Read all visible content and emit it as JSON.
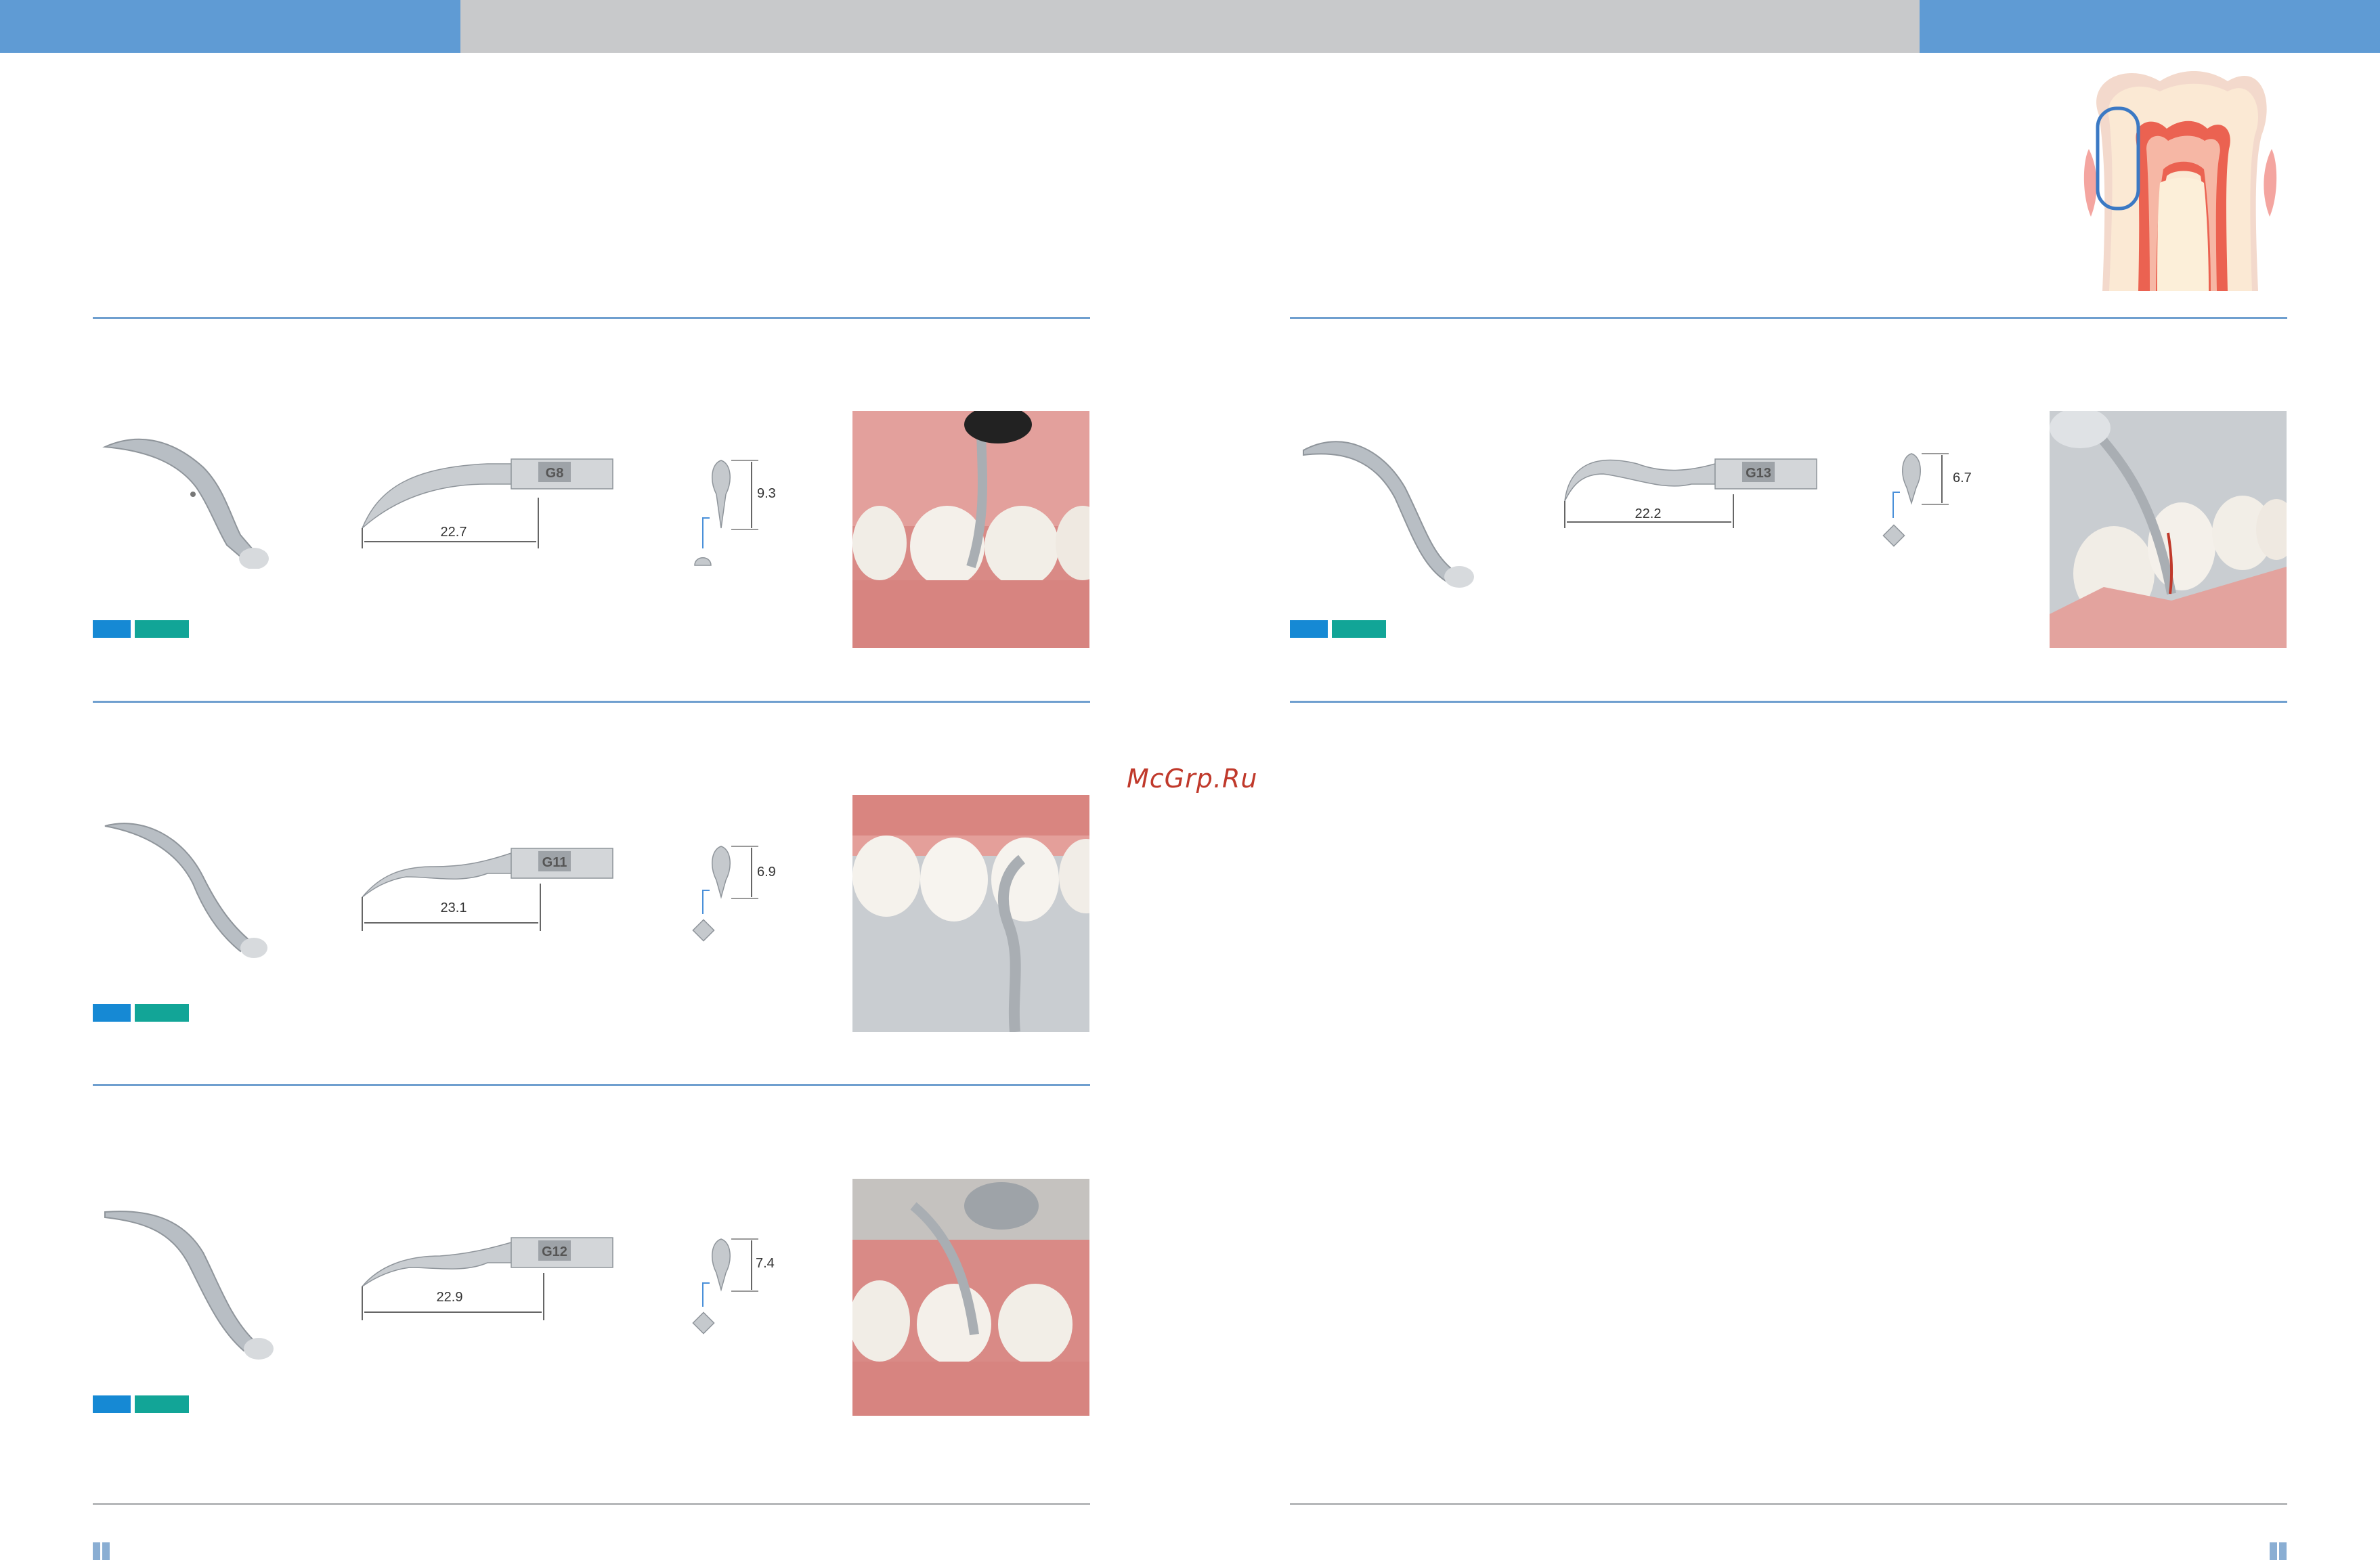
{
  "page": {
    "watermark": "McGrp.Ru",
    "colors": {
      "header_blue": "#5f9bd4",
      "header_grey": "#c8c9cb",
      "rule_blue": "#6f9fcf",
      "tag_blue": "#1689d4",
      "tag_teal": "#12a597",
      "watermark": "#c0392b"
    }
  },
  "tips": [
    {
      "code": "G8",
      "length": "22.7",
      "height": "9.3",
      "end_shape": "round-icon"
    },
    {
      "code": "G11",
      "length": "23.1",
      "height": "6.9",
      "end_shape": "diamond-icon"
    },
    {
      "code": "G12",
      "length": "22.9",
      "height": "7.4",
      "end_shape": "diamond-icon"
    },
    {
      "code": "G13",
      "length": "22.2",
      "height": "6.7",
      "end_shape": "diamond-icon"
    }
  ]
}
